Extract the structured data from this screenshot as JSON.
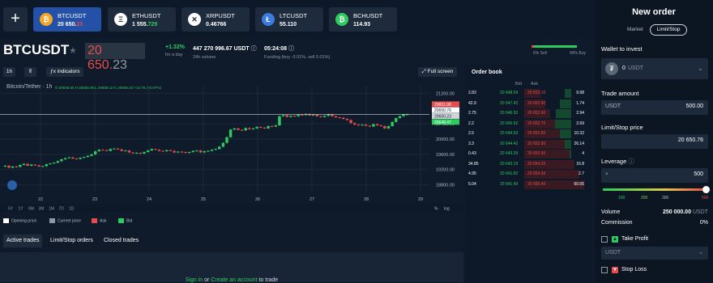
{
  "tickers": [
    {
      "name": "BTCUSDT",
      "price_main": "20 650.",
      "price_tail": "23",
      "dir": "down",
      "icon": "bitcoin-icon",
      "glyph": "₿",
      "color": "#f5a623",
      "active": true
    },
    {
      "name": "ETHUSDT",
      "price_main": "1 555.",
      "price_tail": "729",
      "dir": "up",
      "icon": "ethereum-icon",
      "glyph": "Ξ",
      "color": "#ffffff",
      "active": false
    },
    {
      "name": "XRPUSDT",
      "price_main": "0.46766",
      "price_tail": "",
      "dir": "none",
      "icon": "xrp-icon",
      "glyph": "✕",
      "color": "#ffffff",
      "active": false
    },
    {
      "name": "LTCUSDT",
      "price_main": "55.110",
      "price_tail": "",
      "dir": "none",
      "icon": "litecoin-icon",
      "glyph": "Ł",
      "color": "#3b7be0",
      "active": false
    },
    {
      "name": "BCHUSDT",
      "price_main": "114.93",
      "price_tail": "",
      "dir": "none",
      "icon": "bitcoin-cash-icon",
      "glyph": "₿",
      "color": "#2ecc5e",
      "active": false
    }
  ],
  "header": {
    "symbol": "BTCUSDT",
    "price": "20 650.",
    "price_tail": "23",
    "change": "+1.32%",
    "change_label": "for a day",
    "volume": "447 270 996.67 USDT",
    "volume_label": "24h volume",
    "funding_time": "05:24:08",
    "funding_label": "Funding (buy -0.01%, sell 0.01%)",
    "sell_pct": "6% Sell",
    "buy_pct": "94% Buy",
    "buy_fraction": 0.94
  },
  "controls": {
    "interval": "1h",
    "indicators": "indicators",
    "fullscreen": "Full screen",
    "orderbook": "Order book"
  },
  "chart_data": {
    "type": "candlestick",
    "title": "Bitcoin/Tether · 1h",
    "ohlc_summary": "O 20636.55  H 20668.36  L 20609.10  C 20650.23  +13.76 (+0.07%)",
    "x_ticks": [
      "22",
      "23",
      "24",
      "25",
      "26",
      "27",
      "28",
      "29"
    ],
    "y_ticks": [
      "21200.00",
      "20400.00",
      "20000.00",
      "19600.00",
      "19200.00",
      "18800.00"
    ],
    "y_range": [
      18600,
      21400
    ],
    "price_tags": [
      {
        "value": "20651.98",
        "color": "#e74c4c"
      },
      {
        "value": "20650.76",
        "color": "#ffffff"
      },
      {
        "value": "20650.23",
        "color": "#cfd4da"
      },
      {
        "value": "20648.47",
        "color": "#2ecc5e"
      }
    ],
    "closes": [
      19300,
      19250,
      19280,
      19270,
      19320,
      19350,
      19300,
      19330,
      19310,
      19280,
      19290,
      19340,
      19360,
      19380,
      19420,
      19470,
      19500,
      19520,
      19490,
      19480,
      19510,
      19530,
      19560,
      19600,
      19680,
      19720,
      19710,
      19690,
      19740,
      19750,
      19730,
      19690,
      19700,
      19650,
      19630,
      19640,
      19620,
      19660,
      19700,
      19740,
      19720,
      19690,
      19680,
      19710,
      19690,
      19650,
      19670,
      19660,
      19640,
      19660,
      19690,
      19700,
      19650,
      19680,
      19690,
      19720,
      19740,
      19800,
      19900,
      20050,
      20250,
      20280,
      20240,
      20230,
      20290,
      20260,
      20280,
      20320,
      20300,
      20280,
      20340,
      20330,
      20360,
      20600,
      20630,
      20580,
      20610,
      20600,
      20640,
      20630,
      20660,
      20620,
      20640,
      20600,
      20580,
      20610,
      20650,
      20600,
      20570,
      20560,
      20530,
      20500,
      20420,
      20380,
      20360,
      20380,
      20350,
      20330,
      20390,
      20360,
      20340,
      20280,
      20340,
      20450,
      20550,
      20600,
      20650,
      20650
    ],
    "range_buttons": [
      "5Y",
      "1Y",
      "6M",
      "3M",
      "1M",
      "7D",
      "1D"
    ],
    "axis_modes": [
      "%",
      "log"
    ]
  },
  "legend": [
    {
      "label": "Opening price",
      "color": "#ffffff"
    },
    {
      "label": "Current price",
      "color": "#8c97a6"
    },
    {
      "label": "Ask",
      "color": "#e74c4c"
    },
    {
      "label": "Bid",
      "color": "#2ecc5e"
    }
  ],
  "trade_tabs": [
    "Active trades",
    "Limit/Stop orders",
    "Closed trades"
  ],
  "panel_msg": {
    "sign_in": "Sign in",
    "or": " or ",
    "create": "Create an account",
    "to_trade": " to trade"
  },
  "orderbook": {
    "bid_label": "Bid",
    "ask_label": "Ask",
    "rows": [
      [
        "2.83",
        "20 648.59",
        "20 652.10",
        "9.98"
      ],
      [
        "42.9",
        "20 647.42",
        "20 652.50",
        "1.74"
      ],
      [
        "2.75",
        "20 646.92",
        "20 652.60",
        "2.94"
      ],
      [
        "2.2",
        "20 645.92",
        "20 652.70",
        "2.69"
      ],
      [
        "2.5",
        "20 644.93",
        "20 652.80",
        "10.32"
      ],
      [
        "3.3",
        "20 644.42",
        "20 652.90",
        "26.14"
      ],
      [
        "0.43",
        "20 643.39",
        "20 653.50",
        "4"
      ],
      [
        "34.85",
        "20 643.19",
        "20 654.20",
        "16.8"
      ],
      [
        "4.95",
        "20 641.92",
        "20 654.30",
        "2.7"
      ],
      [
        "5.04",
        "20 641.49",
        "20 655.40",
        "60.06"
      ]
    ]
  },
  "order": {
    "title": "New order",
    "tab_market": "Market",
    "tab_limit": "Limit/Stop",
    "wallet_label": "Wallet to invest",
    "wallet_value": "0",
    "wallet_unit": "USDT",
    "amount_label": "Trade amount",
    "amount_unit": "USDT",
    "amount_value": "500.00",
    "limit_label": "Limit/Stop price",
    "limit_value": "20 650.76",
    "leverage_label": "Leverage",
    "leverage_prefix": "×",
    "leverage_value": "500",
    "leverage_fraction": 1.0,
    "leverage_ticks": [
      "100",
      "200",
      "300",
      "500"
    ],
    "volume_label": "Volume",
    "volume_value": "250 000.00",
    "volume_unit": "USDT",
    "commission_label": "Commission",
    "commission_value": "0%",
    "tp_label": "Take Profit",
    "tp_unit": "USDT",
    "sl_label": "Stop Loss"
  }
}
